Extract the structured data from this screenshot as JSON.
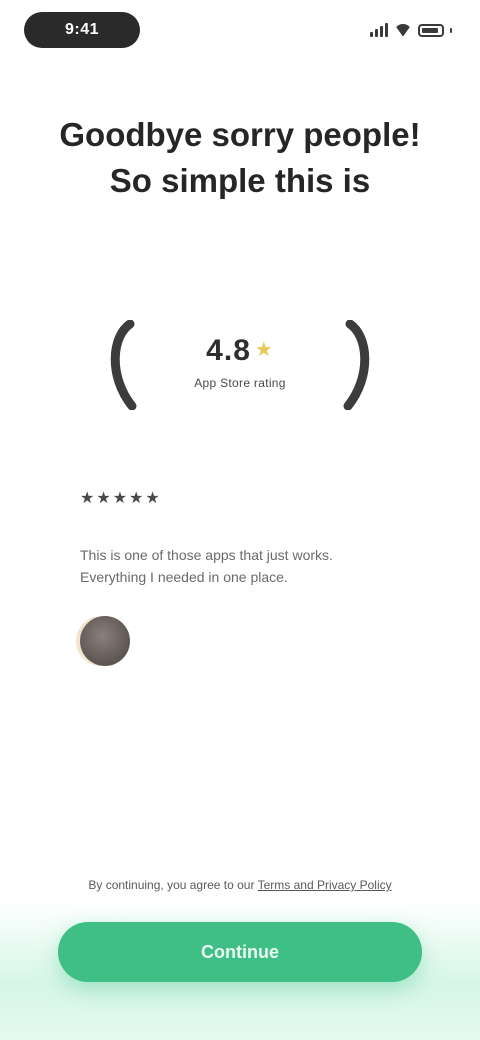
{
  "status_bar": {
    "time": "9:41"
  },
  "back_nav": {
    "label": ""
  },
  "title": "Goodbye sorry people! So simple this is",
  "badge": {
    "value": "4.8",
    "caption": "App Store rating"
  },
  "review": {
    "stars": "★★★★★",
    "text": "This is one of those apps that just works. Everything I needed in one place.",
    "reviewer_name": ""
  },
  "terms": {
    "text": "By continuing, you agree to our ",
    "link": "Terms and Privacy Policy"
  },
  "cta": {
    "label": "Continue"
  },
  "colors": {
    "accent": "#3fbf85",
    "glow": "#d6f6e8",
    "title": "#262626",
    "avatar": "#6b6260",
    "reviewer": "#e4c189"
  },
  "icons": [
    "signal-icon",
    "wifi-icon",
    "battery-icon",
    "laurel-left-icon",
    "laurel-right-icon",
    "star-icon"
  ]
}
